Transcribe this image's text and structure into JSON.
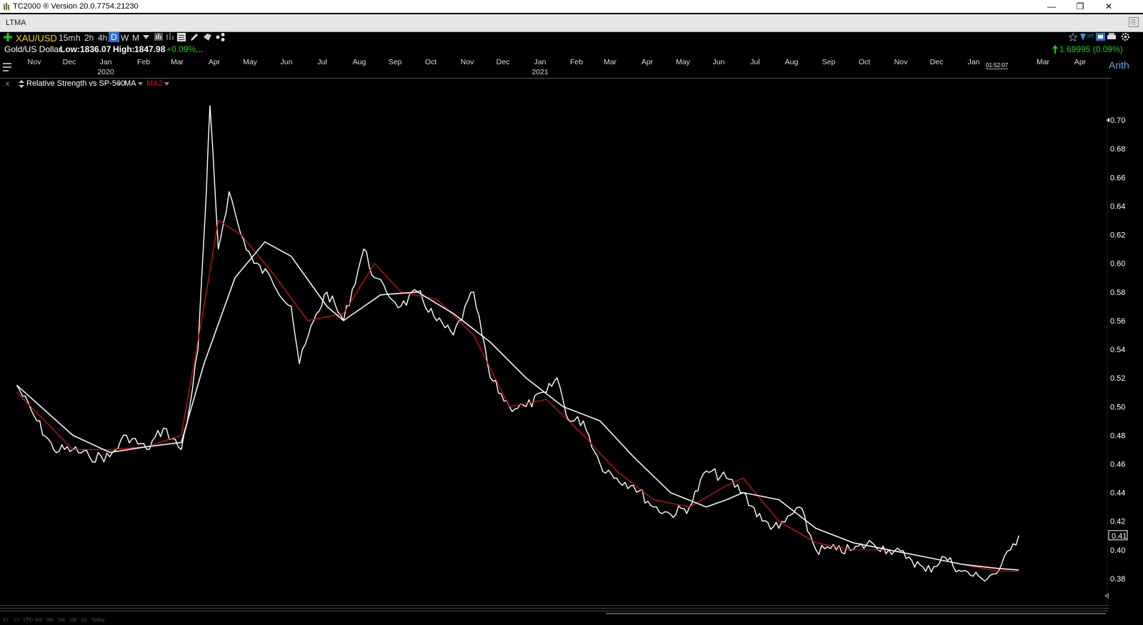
{
  "window": {
    "title": "TC2000 ® Version 20.0.7754.21230",
    "minimize_glyph": "—",
    "restore_glyph": "❐",
    "close_glyph": "✕"
  },
  "layout": {
    "name": "LTMA",
    "menu_glyph": "⎘"
  },
  "toolbar": {
    "symbol": "XAU/USD",
    "intervals": [
      "15m",
      "h",
      "2h",
      "4h",
      "D",
      "W",
      "M"
    ],
    "selected_interval": "D"
  },
  "symbol_bar": {
    "name": "Gold/US Dollar",
    "low_label": "Low:",
    "low_value": "1836.07",
    "high_label": "High:",
    "high_value": "1847.98",
    "change": "+0.09%",
    "ellipsis": "...",
    "last_change": "1.69995 (0.09%)"
  },
  "time_axis": {
    "months": [
      "Nov",
      "Dec",
      "Jan",
      "Feb",
      "Mar",
      "Apr",
      "May",
      "Jun",
      "Jul",
      "Aug",
      "Sep",
      "Oct",
      "Nov",
      "Dec",
      "Jan",
      "Feb",
      "Mar",
      "Apr",
      "May",
      "Jun",
      "Jul",
      "Aug",
      "Sep",
      "Oct",
      "Nov",
      "Dec",
      "Jan",
      "Mar",
      "Apr"
    ],
    "years": [
      "2020",
      "2021"
    ],
    "clock": "01:52:07",
    "scale_mode": "Arith"
  },
  "indicator_bar": {
    "close_glyph": "x",
    "name": "Relative Strength vs SP-500",
    "ma1": "MA",
    "ma2": "MA2"
  },
  "range_buttons": [
    "5Y",
    "1Y",
    "YTD",
    "6M",
    "3M",
    "1M",
    "1W",
    "1D",
    "Today"
  ],
  "colors": {
    "background": "#000000",
    "series": "#ffffff",
    "ma1": "#e01010",
    "ma2": "#f2f2f2",
    "up_green": "#18d018",
    "symbol_yellow": "#ffd400",
    "ma2_label": "#e01010"
  },
  "chart_data": {
    "type": "line",
    "title": "Relative Strength vs SP-500",
    "xlabel": "",
    "ylabel": "",
    "x_range": [
      "2019-10",
      "2022-04"
    ],
    "ylim": [
      0.37,
      0.72
    ],
    "y_ticks": [
      0.38,
      0.4,
      0.42,
      0.44,
      0.46,
      0.48,
      0.5,
      0.52,
      0.54,
      0.56,
      0.58,
      0.6,
      0.62,
      0.64,
      0.66,
      0.68,
      0.7
    ],
    "last_value_label": "0.41",
    "grid": false,
    "series": [
      {
        "name": "Relative Strength vs SP-500",
        "x": [
          "2019-10-15",
          "2019-11-01",
          "2019-11-15",
          "2019-12-01",
          "2019-12-15",
          "2020-01-01",
          "2020-01-15",
          "2020-02-01",
          "2020-02-15",
          "2020-03-01",
          "2020-03-08",
          "2020-03-15",
          "2020-03-22",
          "2020-03-25",
          "2020-04-01",
          "2020-04-10",
          "2020-04-20",
          "2020-05-01",
          "2020-05-15",
          "2020-06-01",
          "2020-06-08",
          "2020-06-20",
          "2020-07-01",
          "2020-07-15",
          "2020-08-01",
          "2020-08-10",
          "2020-08-20",
          "2020-09-01",
          "2020-09-15",
          "2020-10-01",
          "2020-10-15",
          "2020-11-01",
          "2020-11-15",
          "2020-12-01",
          "2020-12-15",
          "2021-01-01",
          "2021-01-10",
          "2021-01-20",
          "2021-02-01",
          "2021-02-15",
          "2021-03-01",
          "2021-03-15",
          "2021-04-01",
          "2021-04-15",
          "2021-05-01",
          "2021-05-15",
          "2021-06-01",
          "2021-06-15",
          "2021-07-01",
          "2021-07-15",
          "2021-08-01",
          "2021-08-15",
          "2021-09-01",
          "2021-09-15",
          "2021-10-01",
          "2021-10-15",
          "2021-11-01",
          "2021-11-15",
          "2021-12-01",
          "2021-12-15",
          "2022-01-01",
          "2022-01-15",
          "2022-01-25",
          "2022-02-01"
        ],
        "values": [
          0.515,
          0.49,
          0.47,
          0.47,
          0.465,
          0.465,
          0.48,
          0.47,
          0.485,
          0.47,
          0.5,
          0.54,
          0.65,
          0.71,
          0.61,
          0.65,
          0.62,
          0.6,
          0.59,
          0.57,
          0.53,
          0.56,
          0.58,
          0.56,
          0.61,
          0.59,
          0.58,
          0.57,
          0.58,
          0.56,
          0.55,
          0.58,
          0.52,
          0.5,
          0.5,
          0.51,
          0.52,
          0.49,
          0.49,
          0.46,
          0.45,
          0.445,
          0.43,
          0.425,
          0.43,
          0.455,
          0.45,
          0.44,
          0.42,
          0.415,
          0.43,
          0.4,
          0.4,
          0.4,
          0.405,
          0.4,
          0.395,
          0.385,
          0.395,
          0.385,
          0.38,
          0.385,
          0.4,
          0.41
        ]
      },
      {
        "name": "MA",
        "x": [
          "2019-10-15",
          "2019-12-01",
          "2020-01-01",
          "2020-02-01",
          "2020-03-01",
          "2020-03-20",
          "2020-04-01",
          "2020-04-20",
          "2020-05-15",
          "2020-06-15",
          "2020-07-15",
          "2020-08-10",
          "2020-09-01",
          "2020-10-01",
          "2020-11-01",
          "2020-12-01",
          "2021-01-01",
          "2021-02-01",
          "2021-03-01",
          "2021-04-01",
          "2021-05-01",
          "2021-06-01",
          "2021-06-15",
          "2021-07-15",
          "2021-08-15",
          "2021-09-15",
          "2021-10-15",
          "2021-11-15",
          "2021-12-15",
          "2022-01-15",
          "2022-02-01"
        ],
        "values": [
          0.51,
          0.47,
          0.47,
          0.472,
          0.48,
          0.57,
          0.63,
          0.62,
          0.595,
          0.56,
          0.565,
          0.6,
          0.58,
          0.575,
          0.55,
          0.5,
          0.505,
          0.48,
          0.455,
          0.435,
          0.43,
          0.445,
          0.45,
          0.42,
          0.405,
          0.4,
          0.4,
          0.395,
          0.39,
          0.385,
          0.385
        ]
      },
      {
        "name": "MA2",
        "x": [
          "2019-10-15",
          "2019-12-01",
          "2020-01-01",
          "2020-02-01",
          "2020-03-01",
          "2020-03-20",
          "2020-04-15",
          "2020-05-10",
          "2020-06-01",
          "2020-07-01",
          "2020-07-15",
          "2020-08-15",
          "2020-09-15",
          "2020-10-15",
          "2020-11-15",
          "2020-12-15",
          "2021-01-15",
          "2021-02-15",
          "2021-03-15",
          "2021-04-15",
          "2021-05-15",
          "2021-06-01",
          "2021-06-15",
          "2021-07-15",
          "2021-08-15",
          "2021-09-15",
          "2021-10-15",
          "2021-11-15",
          "2021-12-15",
          "2022-01-15",
          "2022-02-01"
        ],
        "values": [
          0.515,
          0.48,
          0.468,
          0.472,
          0.475,
          0.53,
          0.59,
          0.615,
          0.605,
          0.57,
          0.56,
          0.578,
          0.58,
          0.565,
          0.545,
          0.52,
          0.5,
          0.49,
          0.465,
          0.44,
          0.43,
          0.435,
          0.44,
          0.435,
          0.415,
          0.405,
          0.4,
          0.395,
          0.39,
          0.387,
          0.386
        ]
      }
    ]
  }
}
